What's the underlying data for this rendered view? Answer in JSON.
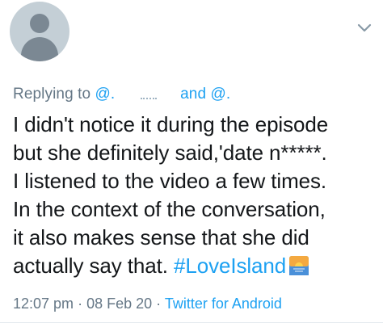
{
  "reply": {
    "prefix": "Replying to",
    "handle_1": "@.",
    "connector": "and",
    "handle_2": "@."
  },
  "tweet": {
    "lines": [
      "I didn't notice it during the episode",
      "but she definitely said,'date n*****.",
      "I listened to the video a few times.",
      "In the context of the conversation,",
      "it also makes sense that she did"
    ],
    "last_line_text": "actually say that.",
    "hashtag": "#LoveIsland",
    "emoji_icon": "sunrise-island-emoji-icon"
  },
  "meta": {
    "time": "12:07 pm",
    "separator_1": "·",
    "date": "08 Feb 20",
    "separator_2": "·",
    "source": "Twitter for Android"
  },
  "colors": {
    "link": "#1da1f2",
    "muted": "#657786",
    "text": "#14171a",
    "avatar_bg": "#c4cfd6"
  }
}
